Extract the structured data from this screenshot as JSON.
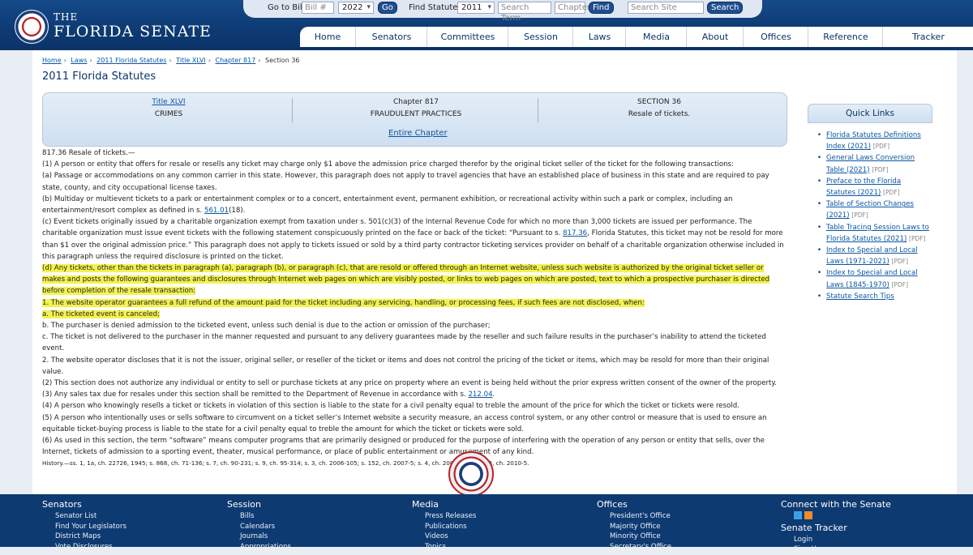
{
  "header": {
    "brand_the": "THE",
    "brand_name": "FLORIDA SENATE",
    "toolbar": {
      "go_to_bill_label": "Go to Bill:",
      "bill_placeholder": "Bill #",
      "bill_year": "2022",
      "go_button": "Go",
      "find_statutes_label": "Find Statutes:",
      "statute_year": "2011",
      "search_term_placeholder": "Search Term",
      "chapter_placeholder": "Chapter",
      "find_button": "Find",
      "search_site_placeholder": "Search Site",
      "search_button": "Search"
    },
    "nav": [
      "Home",
      "Senators",
      "Committees",
      "Session",
      "Laws",
      "Media",
      "About",
      "Offices",
      "Reference",
      "Tracker"
    ]
  },
  "breadcrumb": [
    "Home",
    "Laws",
    "2011 Florida Statutes",
    "Title XLVI",
    "Chapter 817",
    "Section 36"
  ],
  "page_title": "2011 Florida Statutes",
  "info": {
    "title_link": "Title XLVI",
    "title_name": "CRIMES",
    "chapter_label": "Chapter 817",
    "chapter_name": "FRAUDULENT PRACTICES",
    "section_label": "SECTION 36",
    "section_name": "Resale of tickets.",
    "entire_chapter": "Entire Chapter"
  },
  "statute": {
    "heading": "817.36   Resale of tickets.—",
    "p1": "(1)  A person or entity that offers for resale or resells any ticket may charge only $1 above the admission price charged therefor by the original ticket seller of the ticket for the following transactions:",
    "pa": "(a)  Passage or accommodations on any common carrier in this state. However, this paragraph does not apply to travel agencies that have an established place of business in this state and are required to pay state, county, and city occupational license taxes.",
    "pb_pre": "(b)  Multiday or multievent tickets to a park or entertainment complex or to a concert, entertainment event, permanent exhibition, or recreational activity within such a park or complex, including an entertainment/resort complex as defined in s. ",
    "pb_link": "561.01",
    "pb_post": "(18).",
    "pc_pre": "(c)  Event tickets originally issued by a charitable organization exempt from taxation under s. 501(c)(3) of the Internal Revenue Code for which no more than 3,000 tickets are issued per performance. The charitable organization must issue event tickets with the following statement conspicuously printed on the face or back of the ticket: “Pursuant to s. ",
    "pc_link": "817.36",
    "pc_post": ", Florida Statutes, this ticket may not be resold for more than $1 over the original admission price.” This paragraph does not apply to tickets issued or sold by a third party contractor ticketing services provider on behalf of a charitable organization otherwise included in this paragraph unless the required disclosure is printed on the ticket.",
    "pd": "(d)  Any tickets, other than the tickets in paragraph (a), paragraph (b), or paragraph (c), that are resold or offered through an Internet website, unless such website is authorized by the original ticket seller or makes and posts the following guarantees and disclosures through Internet web pages on which are visibly posted, or links to web pages on which are posted, text to which a prospective purchaser is directed before completion of the resale transaction:",
    "n1": "1.   The website operator guarantees a full refund of the amount paid for the ticket including any servicing, handling, or processing fees, if such fees are not disclosed, when:",
    "na": "a.   The ticketed event is canceled;",
    "nb": "b.   The purchaser is denied admission to the ticketed event, unless such denial is due to the action or omission of the purchaser;",
    "nc": "c.   The ticket is not delivered to the purchaser in the manner requested and pursuant to any delivery guarantees made by the reseller and such failure results in the purchaser’s inability to attend the ticketed event.",
    "n2": "2.   The website operator discloses that it is not the issuer, original seller, or reseller of the ticket or items and does not control the pricing of the ticket or items, which may be resold for more than their original value.",
    "p2": "(2)  This section does not authorize any individual or entity to sell or purchase tickets at any price on property where an event is being held without the prior express written consent of the owner of the property.",
    "p3_pre": "(3)  Any sales tax due for resales under this section shall be remitted to the Department of Revenue in accordance with s. ",
    "p3_link": "212.04",
    "p3_post": ".",
    "p4": "(4)  A person who knowingly resells a ticket or tickets in violation of this section is liable to the state for a civil penalty equal to treble the amount of the price for which the ticket or tickets were resold.",
    "p5": "(5)  A person who intentionally uses or sells software to circumvent on a ticket seller’s Internet website a security measure, an access control system, or any other control or measure that is used to ensure an equitable ticket-buying process is liable to the state for a civil penalty equal to treble the amount for which the ticket or tickets were sold.",
    "p6": "(6)  As used in this section, the term “software” means computer programs that are primarily designed or produced for the purpose of interfering with the operation of any person or entity that sells, over the Internet, tickets of admission to a sporting event, theater, musical performance, or place of public entertainment or amusement of any kind.",
    "history": "History.—ss. 1, 1a, ch. 22726, 1945; s. 868, ch. 71-136; s. 7, ch. 90-231; s. 9, ch. 95-314; s. 3, ch. 2006-105; s. 152, ch. 2007-5; s. 4, ch. 2009-179; s. 123, ch. 2010-5."
  },
  "quick_links": {
    "title": "Quick Links",
    "items": [
      {
        "label": "Florida Statutes Definitions Index (2021)",
        "pdf": "[PDF]"
      },
      {
        "label": "General Laws Conversion Table (2021)",
        "pdf": "[PDF]"
      },
      {
        "label": "Preface to the Florida Statutes (2021)",
        "pdf": "[PDF]"
      },
      {
        "label": "Table of Section Changes (2021)",
        "pdf": "[PDF]"
      },
      {
        "label": "Table Tracing Session Laws to Florida Statutes (2021)",
        "pdf": "[PDF]"
      },
      {
        "label": "Index to Special and Local Laws (1971-2021)",
        "pdf": "[PDF]"
      },
      {
        "label": "Index to Special and Local Laws (1845-1970)",
        "pdf": "[PDF]"
      },
      {
        "label": "Statute Search Tips",
        "pdf": ""
      }
    ]
  },
  "footer": {
    "senators": {
      "title": "Senators",
      "items": [
        "Senator List",
        "Find Your Legislators",
        "District Maps",
        "Vote Disclosures"
      ]
    },
    "session": {
      "title": "Session",
      "items": [
        "Bills",
        "Calendars",
        "Journals",
        "Appropriations"
      ]
    },
    "media": {
      "title": "Media",
      "items": [
        "Press Releases",
        "Publications",
        "Videos",
        "Topics"
      ]
    },
    "offices": {
      "title": "Offices",
      "items": [
        "President's Office",
        "Majority Office",
        "Minority Office",
        "Secretary's Office"
      ]
    },
    "connect_title": "Connect with the Senate",
    "tracker_title": "Senate Tracker",
    "tracker_items": [
      "Login",
      "Sign Up"
    ]
  },
  "colors": {
    "navy": "#0e3a72",
    "link": "#0b57a4",
    "highlight": "#f3f24e"
  }
}
